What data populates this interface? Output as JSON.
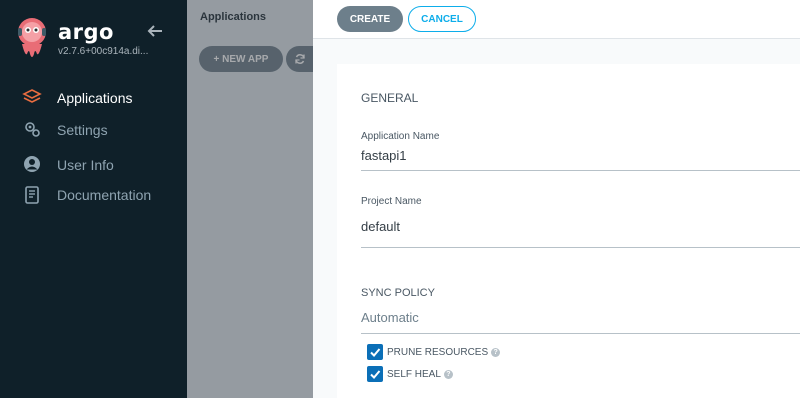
{
  "sidebar": {
    "brand": "argo",
    "version": "v2.7.6+00c914a.di...",
    "items": [
      {
        "label": "Applications",
        "icon": "layers-icon",
        "active": true
      },
      {
        "label": "Settings",
        "icon": "gears-icon",
        "active": false
      },
      {
        "label": "User Info",
        "icon": "user-circle-icon",
        "active": false
      },
      {
        "label": "Documentation",
        "icon": "book-icon",
        "active": false
      }
    ]
  },
  "header": {
    "title": "Applications"
  },
  "toolbar": {
    "new_app_label": "+ NEW APP",
    "sync_icon": "sync-icon"
  },
  "panel": {
    "create_label": "CREATE",
    "cancel_label": "CANCEL",
    "general_title": "GENERAL",
    "app_name_label": "Application Name",
    "app_name_value": "fastapi1",
    "project_label": "Project Name",
    "project_value": "default",
    "sync_policy_title": "SYNC POLICY",
    "sync_policy_value": "Automatic",
    "prune_label": "PRUNE RESOURCES",
    "prune_checked": true,
    "self_heal_label": "SELF HEAL",
    "self_heal_checked": true
  },
  "colors": {
    "sidebar_bg": "#0f2029",
    "accent": "#0dadea",
    "checkbox": "#0b6fb7",
    "button_gray": "#6d7f8b"
  }
}
